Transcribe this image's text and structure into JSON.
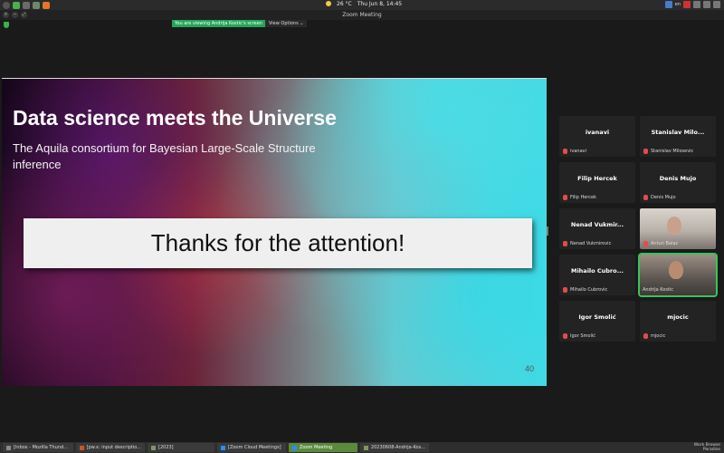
{
  "top_panel": {
    "temperature": "26 °C",
    "datetime": "Thu Jun 8, 14:45",
    "keyboard_layout": "en"
  },
  "window": {
    "title": "Zoom Meeting"
  },
  "share_banner": {
    "viewing_label": "You are viewing Andrija Kostic's screen",
    "view_options": "View Options ⌄"
  },
  "slide": {
    "title": "Data science meets the Universe",
    "subtitle": "The Aquila consortium for Bayesian Large-Scale Structure inference",
    "thanks": "Thanks for the attention!",
    "page_number": "40"
  },
  "participants": [
    {
      "display": "ivanavi",
      "name": "ivanavi"
    },
    {
      "display": "Stanislav Milo...",
      "name": "Stanislav Milosevic"
    },
    {
      "display": "Filip Hercek",
      "name": "Filip Hercek"
    },
    {
      "display": "Denis Mujo",
      "name": "Denis Mujo"
    },
    {
      "display": "Nenad Vukmir...",
      "name": "Nenad Vukmirovic"
    },
    {
      "display": "",
      "name": "Antun Balaz"
    },
    {
      "display": "Mihailo Cubro...",
      "name": "Mihailo Cubrovic"
    },
    {
      "display": "",
      "name": "Andrija Kostic"
    },
    {
      "display": "Igor Smolić",
      "name": "Igor Smolić"
    },
    {
      "display": "mjocic",
      "name": "mjocic"
    }
  ],
  "taskbar": {
    "items": [
      "[Inbox - Mozilla Thund...",
      "[pw.x: input descriptio...",
      "[2023]",
      "[Zoom Cloud Meetings]",
      "Zoom Meeting",
      "20230608-Andrija-Kos..."
    ],
    "workspace": "Work Browse Paradise"
  },
  "colors": {
    "share_banner_green": "#25a55a",
    "active_speaker": "#3bc25a",
    "muted_mic": "#e14c4c"
  }
}
